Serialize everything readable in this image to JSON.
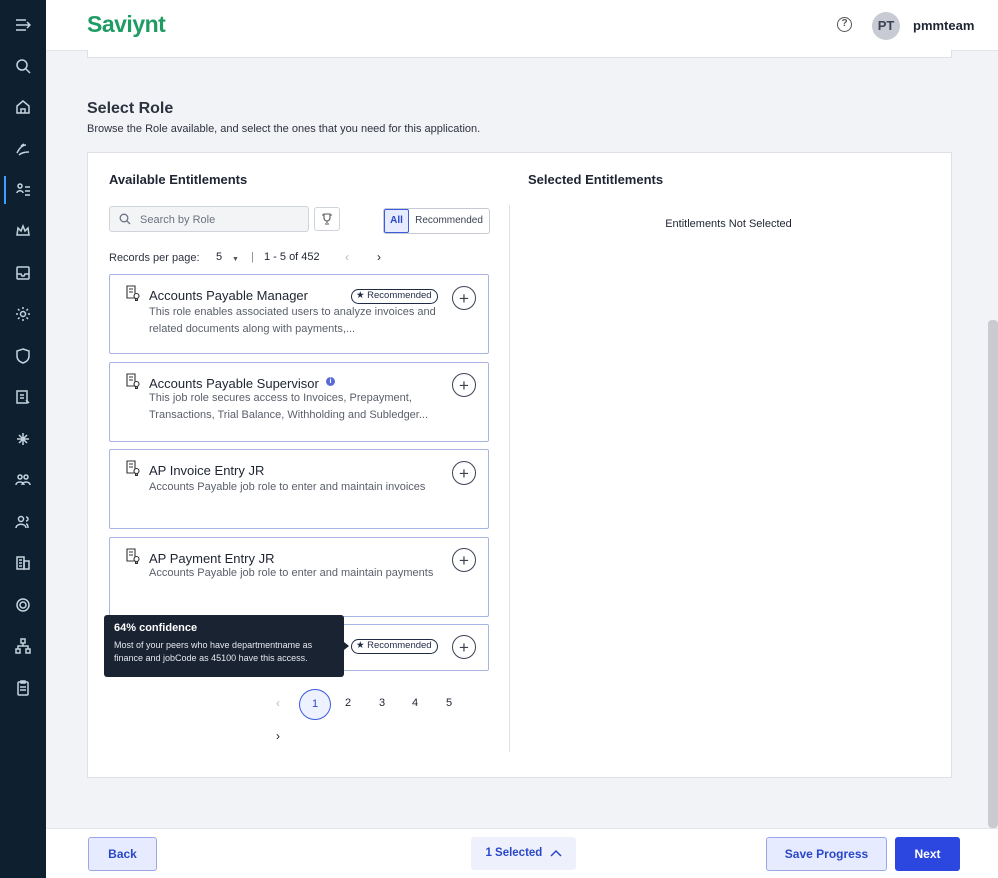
{
  "app": {
    "logo_text": "Saviynt",
    "help_glyph": "?",
    "user_initials": "PT",
    "username": "pmmteam"
  },
  "sidebar": {
    "icons": [
      "menu-collapse-icon",
      "search-icon",
      "home-icon",
      "requests-icon",
      "access-icon",
      "crown-icon",
      "inbox-icon",
      "settings-icon",
      "shield-icon",
      "certification-icon",
      "asterisk-icon",
      "groups-icon",
      "users-icon",
      "building-icon",
      "gear-icon",
      "hierarchy-icon",
      "clipboard-icon"
    ]
  },
  "section": {
    "title": "Select Role",
    "description": "Browse the Role available, and select the ones that you need for this application."
  },
  "available": {
    "title": "Available Entitlements",
    "search_placeholder": "Search by Role",
    "filter_all": "All",
    "filter_recommended": "Recommended",
    "records_label": "Records per page:",
    "records_value": "5",
    "separator": "|",
    "range": "1 - 5 of 452",
    "prev_glyph": "‹",
    "next_glyph": "›"
  },
  "selected": {
    "title": "Selected Entitlements",
    "empty": "Entitlements Not Selected"
  },
  "cards": [
    {
      "name": "Accounts Payable Manager",
      "desc": "This role enables associated users to analyze invoices and related documents along with payments,...",
      "recommended": "Recommended"
    },
    {
      "name": "Accounts Payable Supervisor",
      "desc": "This job role secures access to Invoices, Prepayment, Transactions, Trial Balance, Withholding and Subledger...",
      "info": "i"
    },
    {
      "name": "AP Invoice Entry JR",
      "desc": "Accounts Payable job role to enter and maintain invoices"
    },
    {
      "name": "AP Payment Entry JR",
      "desc": "Accounts Payable job role to enter and maintain payments"
    },
    {
      "recommended": "Recommended"
    }
  ],
  "add_glyph": "+",
  "tooltip": {
    "title": "64% confidence",
    "body": "Most of your peers who have departmentname as finance and jobCode as 45100 have this access."
  },
  "pagination": {
    "current": "1",
    "pages": [
      "2",
      "3",
      "4",
      "5"
    ],
    "prev_glyph": "‹",
    "next_glyph": "›"
  },
  "footer": {
    "back": "Back",
    "selected": "1 Selected",
    "save": "Save Progress",
    "next": "Next"
  },
  "colors": {
    "brand": "#1e9c63",
    "accent": "#2b47e0",
    "sidebar": "#0e2030"
  }
}
